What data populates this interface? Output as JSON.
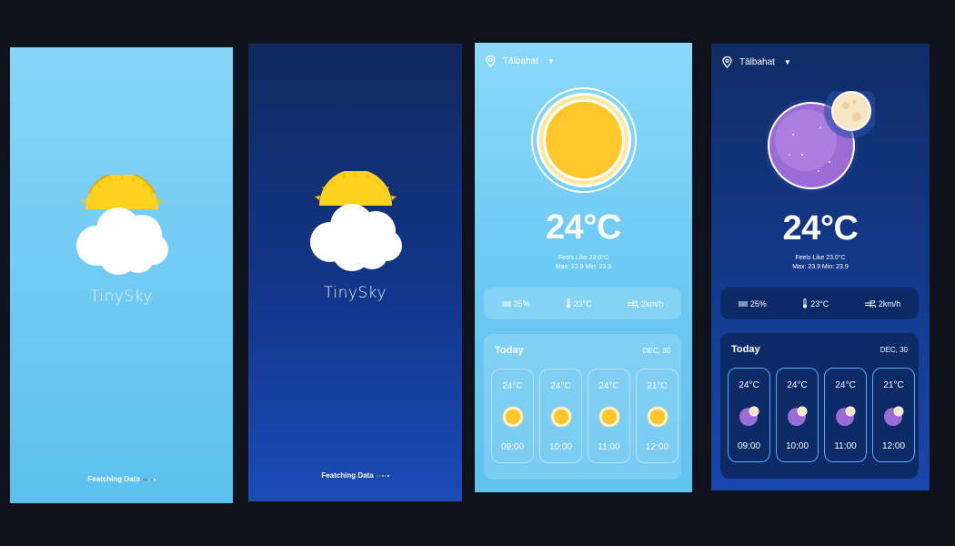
{
  "splash": {
    "app_name": "TinySky",
    "loading_text": "Featching Data"
  },
  "weather": {
    "location": "Tālbahat",
    "temperature": "24°C",
    "feels_like": "Feels Like 23.0°C",
    "max_min": "Max: 23.9  Min: 23.9",
    "stats": {
      "humidity": "25%",
      "feels_temp": "23°C",
      "wind": "2km/h"
    },
    "today": {
      "title": "Today",
      "date": "DEC, 30",
      "hours": [
        {
          "temp": "24°C",
          "time": "09:00"
        },
        {
          "temp": "24°C",
          "time": "10:00"
        },
        {
          "temp": "24°C",
          "time": "11:00"
        },
        {
          "temp": "21°C",
          "time": "12:00"
        }
      ]
    }
  },
  "icons": {
    "location": "map-pin-icon",
    "dropdown": "caret-down-icon",
    "humidity": "haze-lines-icon",
    "thermometer": "thermometer-icon",
    "wind": "wind-icon",
    "logo": "sun-behind-cloud-icon",
    "day_hero": "sun-icon",
    "night_hero": "moon-planet-icon"
  },
  "colors": {
    "sun": "#FFC72C",
    "day_bg": "#7CD1F7",
    "night_bg": "#133A8C",
    "moon_planet": "#9B6BD6"
  }
}
